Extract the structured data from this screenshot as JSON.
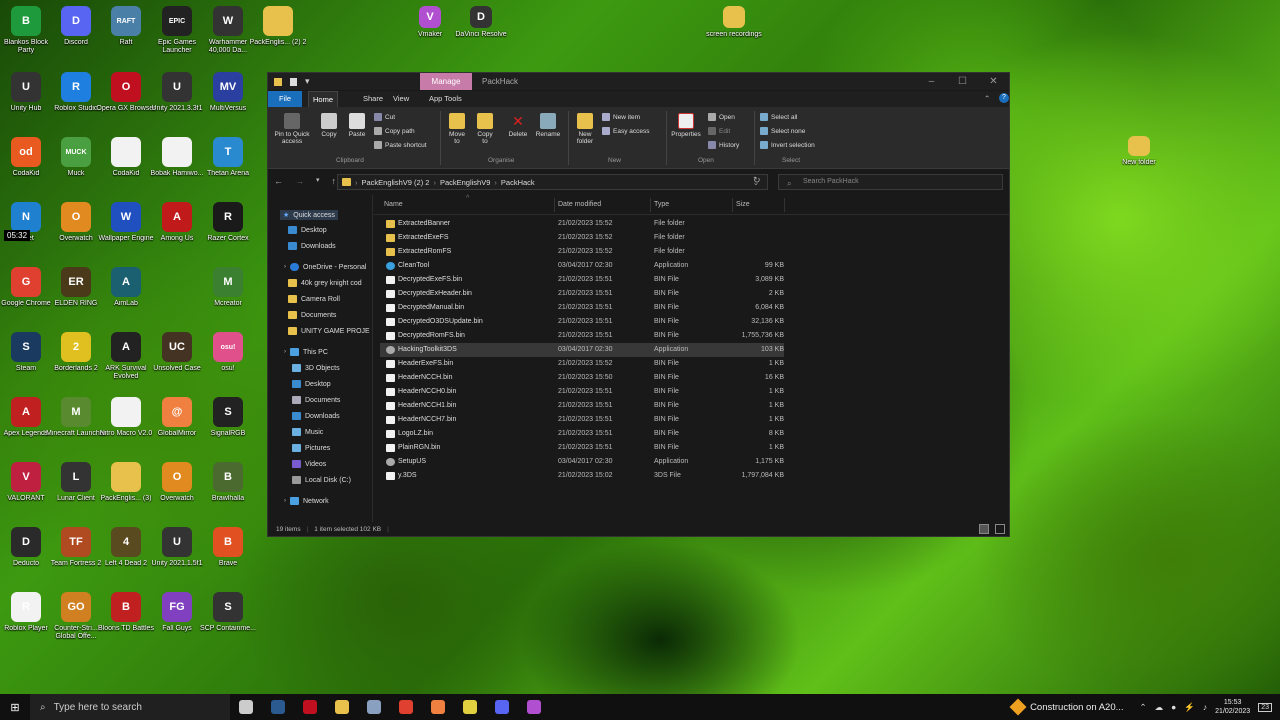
{
  "desktop": {
    "icons": [
      {
        "label": "Blankos Block Party",
        "color": "#1e9a3c",
        "glyph": "B"
      },
      {
        "label": "Discord",
        "color": "#5865f2",
        "glyph": "D"
      },
      {
        "label": "Raft",
        "color": "#4a7fa8",
        "glyph": "RAFT"
      },
      {
        "label": "Epic Games Launcher",
        "color": "#222222",
        "glyph": "EPIC"
      },
      {
        "label": "Warhammer 40,000 Da...",
        "color": "#333333",
        "glyph": "W"
      },
      {
        "label": "PackEnglis... (2) 2",
        "color": "#e8c14c",
        "glyph": ""
      },
      {
        "label": "Unity Hub",
        "color": "#333333",
        "glyph": "U"
      },
      {
        "label": "Roblox Studio",
        "color": "#1f7fe0",
        "glyph": "R"
      },
      {
        "label": "Opera GX Browser",
        "color": "#c01020",
        "glyph": "O"
      },
      {
        "label": "Unity 2021.3.3f1",
        "color": "#333333",
        "glyph": "U"
      },
      {
        "label": "MultiVersus",
        "color": "#2a3fa0",
        "glyph": "MV"
      },
      {
        "label": "CodaKid",
        "color": "#e85a20",
        "glyph": "od"
      },
      {
        "label": "Muck",
        "color": "#4aa040",
        "glyph": "MUCK"
      },
      {
        "label": "CodaKid",
        "color": "#f2f2f2",
        "glyph": ""
      },
      {
        "label": "Bobak Hamiwo...",
        "color": "#f2f2f2",
        "glyph": ""
      },
      {
        "label": "Thetan Arena",
        "color": "#2a8ad0",
        "glyph": "T"
      },
      {
        "label": "...net",
        "color": "#2080d0",
        "glyph": "N"
      },
      {
        "label": "Overwatch",
        "color": "#e08a20",
        "glyph": "O"
      },
      {
        "label": "Wallpaper Engine",
        "color": "#2050c0",
        "glyph": "W"
      },
      {
        "label": "Among Us",
        "color": "#c01a1a",
        "glyph": "A"
      },
      {
        "label": "Razer Cortex",
        "color": "#1a1a1a",
        "glyph": "R"
      },
      {
        "label": "Google Chrome",
        "color": "#e04030",
        "glyph": "G"
      },
      {
        "label": "ELDEN RING",
        "color": "#4a3a1a",
        "glyph": "ER"
      },
      {
        "label": "AimLab",
        "color": "#1a6070",
        "glyph": "A"
      },
      {
        "label": "Mcreator",
        "color": "#3a8030",
        "glyph": "M"
      },
      {
        "label": "Steam",
        "color": "#1a3a60",
        "glyph": "S"
      },
      {
        "label": "Borderlands 2",
        "color": "#e0c020",
        "glyph": "2"
      },
      {
        "label": "ARK Survival Evolved",
        "color": "#222222",
        "glyph": "A"
      },
      {
        "label": "Unsolved Case",
        "color": "#443322",
        "glyph": "UC"
      },
      {
        "label": "osu!",
        "color": "#e0508a",
        "glyph": "osu!"
      },
      {
        "label": "Apex Legends",
        "color": "#c02020",
        "glyph": "A"
      },
      {
        "label": "Minecraft Launcher",
        "color": "#5a8a30",
        "glyph": "M"
      },
      {
        "label": "Nitro Macro V2.0",
        "color": "#f2f2f2",
        "glyph": ""
      },
      {
        "label": "GlobalMirror",
        "color": "#f08040",
        "glyph": "@"
      },
      {
        "label": "SignalRGB",
        "color": "#222222",
        "glyph": "S"
      },
      {
        "label": "VALORANT",
        "color": "#c02040",
        "glyph": "V"
      },
      {
        "label": "Lunar Client",
        "color": "#333333",
        "glyph": "L"
      },
      {
        "label": "PackEnglis... (3)",
        "color": "#e8c14c",
        "glyph": ""
      },
      {
        "label": "Overwatch",
        "color": "#e08a20",
        "glyph": "O"
      },
      {
        "label": "Brawlhalla",
        "color": "#4a6a30",
        "glyph": "B"
      },
      {
        "label": "Deducto",
        "color": "#2a2a2a",
        "glyph": "D"
      },
      {
        "label": "Team Fortress 2",
        "color": "#b04a20",
        "glyph": "TF"
      },
      {
        "label": "Left 4 Dead 2",
        "color": "#5a4a20",
        "glyph": "4"
      },
      {
        "label": "Unity 2021.1.5f1",
        "color": "#333333",
        "glyph": "U"
      },
      {
        "label": "Brave",
        "color": "#e05020",
        "glyph": "B"
      },
      {
        "label": "Roblox Player",
        "color": "#f2f2f2",
        "glyph": "R"
      },
      {
        "label": "Counter-Stri... Global Offe...",
        "color": "#d08020",
        "glyph": "GO"
      },
      {
        "label": "Bloons TD Battles",
        "color": "#c02020",
        "glyph": "B"
      },
      {
        "label": "Fall Guys",
        "color": "#8040c0",
        "glyph": "FG"
      },
      {
        "label": "SCP Containme...",
        "color": "#333333",
        "glyph": "S"
      }
    ],
    "top_icons": [
      {
        "label": "Vmaker",
        "color": "#b050d0",
        "glyph": "V"
      },
      {
        "label": "DaVinci Resolve",
        "color": "#333333",
        "glyph": "D"
      },
      {
        "label": "screen recordings",
        "color": "#e8c14c",
        "glyph": ""
      }
    ],
    "right_icon": {
      "label": "New folder",
      "color": "#e8c14c"
    },
    "clock_overlay": "05:32"
  },
  "explorer": {
    "title": "PackHack",
    "manage_tab": "Manage",
    "tabs": {
      "file": "File",
      "home": "Home",
      "share": "Share",
      "view": "View",
      "app_tools": "App Tools"
    },
    "ribbon": {
      "pin": "Pin to Quick access",
      "copy": "Copy",
      "paste": "Paste",
      "cut": "Cut",
      "copy_path": "Copy path",
      "paste_shortcut": "Paste shortcut",
      "move_to": "Move to",
      "copy_to": "Copy to",
      "delete": "Delete",
      "rename": "Rename",
      "new_folder": "New folder",
      "new_item": "New item",
      "easy_access": "Easy access",
      "properties": "Properties",
      "open": "Open",
      "edit": "Edit",
      "history": "History",
      "select_all": "Select all",
      "select_none": "Select none",
      "invert_selection": "Invert selection",
      "groups": {
        "clipboard": "Clipboard",
        "organise": "Organise",
        "new": "New",
        "open": "Open",
        "select": "Select"
      }
    },
    "breadcrumb": [
      "PackEnglishV9 (2) 2",
      "PackEnglishV9",
      "PackHack"
    ],
    "search_placeholder": "Search PackHack",
    "nav": {
      "quick_access": "Quick access",
      "qa_items": [
        "Desktop",
        "Downloads"
      ],
      "onedrive": "OneDrive - Personal",
      "od_items": [
        "40k grey knight cod",
        "Camera Roll",
        "Documents",
        "UNITY GAME PROJE"
      ],
      "this_pc": "This PC",
      "pc_items": [
        "3D Objects",
        "Desktop",
        "Documents",
        "Downloads",
        "Music",
        "Pictures",
        "Videos",
        "Local Disk (C:)"
      ],
      "network": "Network"
    },
    "columns": {
      "name": "Name",
      "date": "Date modified",
      "type": "Type",
      "size": "Size"
    },
    "files": [
      {
        "name": "ExtractedBanner",
        "date": "21/02/2023 15:52",
        "type": "File folder",
        "size": "",
        "icon": "folder"
      },
      {
        "name": "ExtractedExeFS",
        "date": "21/02/2023 15:52",
        "type": "File folder",
        "size": "",
        "icon": "folder"
      },
      {
        "name": "ExtractedRomFS",
        "date": "21/02/2023 15:52",
        "type": "File folder",
        "size": "",
        "icon": "folder"
      },
      {
        "name": "CleanTool",
        "date": "03/04/2017 02:30",
        "type": "Application",
        "size": "99 KB",
        "icon": "app"
      },
      {
        "name": "DecryptedExeFS.bin",
        "date": "21/02/2023 15:51",
        "type": "BIN File",
        "size": "3,089 KB",
        "icon": "file"
      },
      {
        "name": "DecryptedExHeader.bin",
        "date": "21/02/2023 15:51",
        "type": "BIN File",
        "size": "2 KB",
        "icon": "file"
      },
      {
        "name": "DecryptedManual.bin",
        "date": "21/02/2023 15:51",
        "type": "BIN File",
        "size": "6,084 KB",
        "icon": "file"
      },
      {
        "name": "DecryptedO3DSUpdate.bin",
        "date": "21/02/2023 15:51",
        "type": "BIN File",
        "size": "32,136 KB",
        "icon": "file"
      },
      {
        "name": "DecryptedRomFS.bin",
        "date": "21/02/2023 15:51",
        "type": "BIN File",
        "size": "1,755,736 KB",
        "icon": "file"
      },
      {
        "name": "HackingToolkit3DS",
        "date": "03/04/2017 02:30",
        "type": "Application",
        "size": "103 KB",
        "icon": "gear"
      },
      {
        "name": "HeaderExeFS.bin",
        "date": "21/02/2023 15:52",
        "type": "BIN File",
        "size": "1 KB",
        "icon": "file"
      },
      {
        "name": "HeaderNCCH.bin",
        "date": "21/02/2023 15:50",
        "type": "BIN File",
        "size": "16 KB",
        "icon": "file"
      },
      {
        "name": "HeaderNCCH0.bin",
        "date": "21/02/2023 15:51",
        "type": "BIN File",
        "size": "1 KB",
        "icon": "file"
      },
      {
        "name": "HeaderNCCH1.bin",
        "date": "21/02/2023 15:51",
        "type": "BIN File",
        "size": "1 KB",
        "icon": "file"
      },
      {
        "name": "HeaderNCCH7.bin",
        "date": "21/02/2023 15:51",
        "type": "BIN File",
        "size": "1 KB",
        "icon": "file"
      },
      {
        "name": "LogoLZ.bin",
        "date": "21/02/2023 15:51",
        "type": "BIN File",
        "size": "8 KB",
        "icon": "file"
      },
      {
        "name": "PlainRGN.bin",
        "date": "21/02/2023 15:51",
        "type": "BIN File",
        "size": "1 KB",
        "icon": "file"
      },
      {
        "name": "SetupUS",
        "date": "03/04/2017 02:30",
        "type": "Application",
        "size": "1,175 KB",
        "icon": "gear"
      },
      {
        "name": "y.3DS",
        "date": "21/02/2023 15:02",
        "type": "3DS File",
        "size": "1,797,084 KB",
        "icon": "file"
      }
    ],
    "status": {
      "count": "19 items",
      "selected": "1 item selected  102 KB"
    }
  },
  "taskbar": {
    "search_placeholder": "Type here to search",
    "weather": "Construction on A20...",
    "time": "15:53",
    "date": "21/02/2023",
    "notifications": "23",
    "apps": [
      {
        "name": "task-view",
        "color": "#cccccc"
      },
      {
        "name": "steam",
        "color": "#2a5a90"
      },
      {
        "name": "opera-gx",
        "color": "#c01020"
      },
      {
        "name": "file-explorer",
        "color": "#e8c14c"
      },
      {
        "name": "notepad",
        "color": "#8aa0c0"
      },
      {
        "name": "chrome",
        "color": "#e04030"
      },
      {
        "name": "globalmirror",
        "color": "#f08040"
      },
      {
        "name": "lemon",
        "color": "#e0d040"
      },
      {
        "name": "discord",
        "color": "#5865f2"
      },
      {
        "name": "vmaker",
        "color": "#b050d0"
      }
    ]
  }
}
